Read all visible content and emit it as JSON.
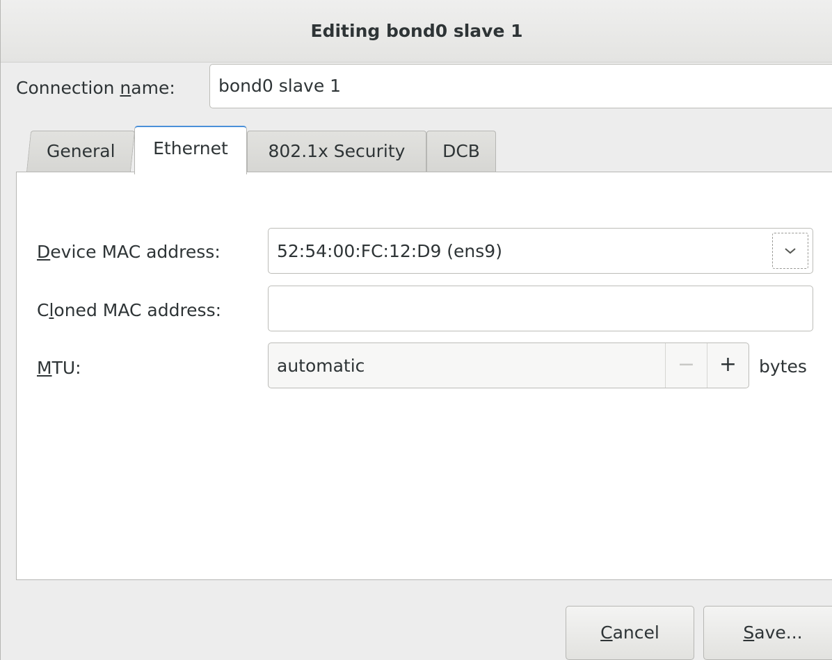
{
  "window": {
    "title": "Editing bond0 slave 1"
  },
  "connection": {
    "label_pre": "Connection ",
    "label_mnemonic": "n",
    "label_post": "ame:",
    "value": "bond0 slave 1"
  },
  "tabs": [
    {
      "label": "General",
      "active": false
    },
    {
      "label": "Ethernet",
      "active": true
    },
    {
      "label": "802.1x Security",
      "active": false
    },
    {
      "label": "DCB",
      "active": false
    }
  ],
  "ethernet": {
    "device_mac": {
      "label_mnemonic": "D",
      "label_post": "evice MAC address:",
      "value": "52:54:00:FC:12:D9 (ens9)",
      "dropdown_icon": "chevron-down-icon"
    },
    "cloned_mac": {
      "label_pre": "C",
      "label_mnemonic": "l",
      "label_post": "oned MAC address:",
      "value": ""
    },
    "mtu": {
      "label_mnemonic": "M",
      "label_post": "TU:",
      "value": "automatic",
      "decrement_glyph": "−",
      "increment_glyph": "+",
      "unit": "bytes"
    }
  },
  "buttons": {
    "cancel": {
      "mnemonic": "C",
      "rest": "ancel"
    },
    "save": {
      "mnemonic": "S",
      "rest": "ave..."
    }
  },
  "colors": {
    "active_tab_accent": "#4a90d9",
    "window_bg": "#ededed"
  }
}
